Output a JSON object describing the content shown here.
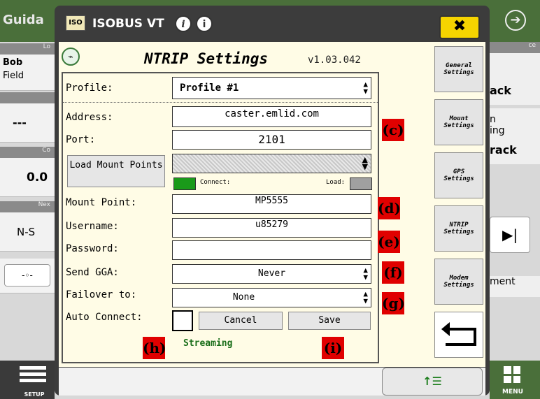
{
  "background": {
    "title": "Guida",
    "left_panel": {
      "row1_header": "Lo",
      "row1_line1": "Bob",
      "row1_line2": "Field",
      "row2_value": "---",
      "row3_header": "Co",
      "row3_value": "0.0",
      "row4_header": "Nex",
      "row4_value": "N-S"
    },
    "right_panel": {
      "header": "ce",
      "text1": "ack",
      "text2": "n",
      "text3": "ing",
      "text4": "rack",
      "text5": "ment",
      "menu_label": "MENU"
    },
    "bottom_left_label": "SETUP"
  },
  "dialog": {
    "iso_logo": "ISO",
    "title": "ISOBUS VT",
    "info_icon_1": "i",
    "info_icon_2": "i",
    "close_label": "✖"
  },
  "ntrip": {
    "title": "NTRIP Settings",
    "version": "v1.03.042",
    "fields": {
      "profile_label": "Profile:",
      "profile_value": "Profile #1",
      "address_label": "Address:",
      "address_value": "caster.emlid.com",
      "port_label": "Port:",
      "port_value": "2101",
      "load_mount_points_label": "Load Mount Points",
      "connect_label": "Connect:",
      "load_label": "Load:",
      "mount_point_label": "Mount Point:",
      "mount_point_value": "MP5555",
      "username_label": "Username:",
      "username_value": "u85279",
      "password_label": "Password:",
      "password_value": "",
      "send_gga_label": "Send GGA:",
      "send_gga_value": "Never",
      "failover_label": "Failover to:",
      "failover_value": "None",
      "auto_connect_label": "Auto Connect:",
      "cancel_label": "Cancel",
      "save_label": "Save",
      "status_text": "Streaming"
    },
    "tags": {
      "c": "(c)",
      "d": "(d)",
      "e": "(e)",
      "f": "(f)",
      "g": "(g)",
      "h": "(h)",
      "i": "(i)"
    }
  },
  "tabs": [
    {
      "label": "General Settings"
    },
    {
      "label": "Mount Settings"
    },
    {
      "label": "GPS Settings"
    },
    {
      "label": "NTRIP Settings"
    },
    {
      "label": "Modem Settings"
    }
  ],
  "colors": {
    "connect_indicator": "#1a9a1a",
    "load_indicator": "#a0a0a0",
    "status_green": "#1a6e1a",
    "close_yellow": "#f5d400",
    "tag_red": "#e00000"
  }
}
